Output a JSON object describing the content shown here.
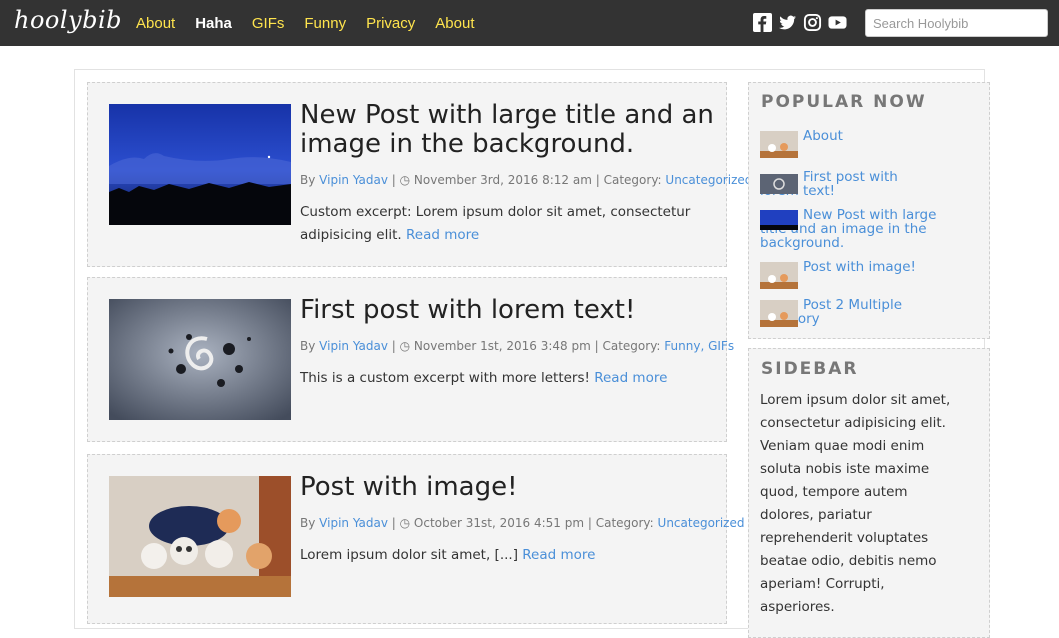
{
  "header": {
    "logo": "hoolybib",
    "nav": [
      "About",
      "Haha",
      "GIFs",
      "Funny",
      "Privacy",
      "About"
    ],
    "active_index": 1,
    "search_placeholder": "Search Hoolybib",
    "social_icons": [
      "facebook-icon",
      "twitter-icon",
      "instagram-icon",
      "youtube-icon"
    ]
  },
  "posts": [
    {
      "title": "New Post with large title and an image in the background.",
      "author": "Vipin Yadav",
      "date": "November 3rd, 2016 8:12 am",
      "category_label": "Category:",
      "categories": "Uncategorized",
      "excerpt": "Custom excerpt: Lorem ipsum dolor sit amet, consectetur adipisicing elit.",
      "read_more": "Read more"
    },
    {
      "title": "First post with lorem text!",
      "author": "Vipin Yadav",
      "date": "November 1st, 2016 3:48 pm",
      "category_label": "Category:",
      "categories": "Funny, GIFs",
      "excerpt": "This is a custom excerpt with more letters!",
      "read_more": "Read more"
    },
    {
      "title": "Post with image!",
      "author": "Vipin Yadav",
      "date": "October 31st, 2016 4:51 pm",
      "category_label": "Category:",
      "categories": "Uncategorized",
      "excerpt": "Lorem ipsum dolor sit amet, [...]",
      "read_more": "Read more"
    }
  ],
  "meta_by": "By",
  "popular": {
    "title": "POPULAR NOW",
    "items": [
      "About",
      "First post with lorem text!",
      "New Post with large title and an image in the background.",
      "Post with image!",
      "Post 2 Multiple category"
    ]
  },
  "sidebar": {
    "title": "SIDEBAR",
    "text": "Lorem ipsum dolor sit amet, consectetur adipisicing elit. Veniam quae modi enim soluta nobis iste maxime quod, tempore autem dolores, pariatur reprehenderit voluptates beatae odio, debitis nemo aperiam! Corrupti, asperiores."
  }
}
